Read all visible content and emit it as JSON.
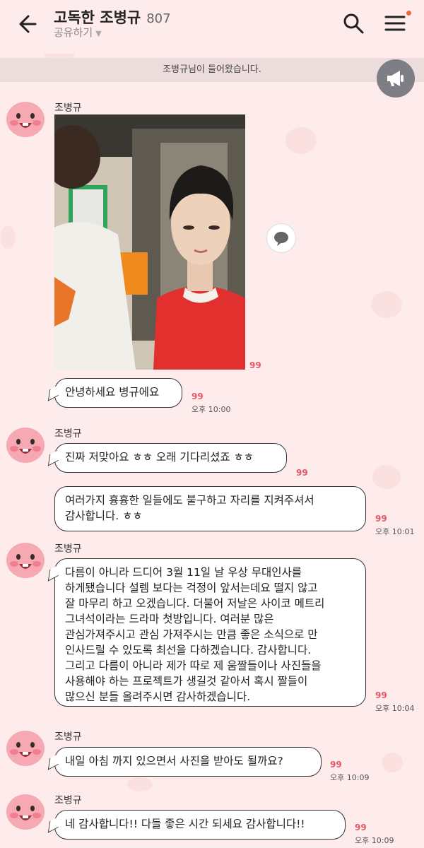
{
  "header": {
    "title": "고독한 조병규",
    "member_count": "807",
    "share_label": "공유하기"
  },
  "notice": {
    "text": "조병규님이 들어왔습니다."
  },
  "messages": {
    "m1": {
      "sender": "조병규",
      "unread_photo": "99",
      "text": "안녕하세요 병규에요",
      "unread": "99",
      "time": "오후 10:00"
    },
    "m2": {
      "sender": "조병규",
      "text1": "진짜 저맞아요 ㅎㅎ 오래 기다리셨죠 ㅎㅎ",
      "unread1": "99",
      "text2_l1": "여러가지 흉흉한 일들에도 불구하고 자리를 지켜주셔서",
      "text2_l2": "감사합니다. ㅎㅎ",
      "unread2": "99",
      "time": "오후 10:01"
    },
    "m3": {
      "sender": "조병규",
      "lines": [
        "다름이 아니라 드디어 3월 11일 날 우상 무대인사를",
        "하게됐습니다 설렘 보다는 걱정이 앞서는데요 떨지 않고",
        "잘 마무리 하고 오겠습니다. 더불어 저날은 사이코 메트리",
        "그녀석이라는 드라마 첫방입니다. 여러분 많은",
        "관심가져주시고 관심 가져주시는 만큼 좋은 소식으로 만",
        "인사드릴 수 있도록 최선을 다하겠습니다. 감사합니다.",
        "그리고 다름이 아니라 제가 따로 제 움짤들이나 사진들을",
        "사용해야 하는 프로젝트가 생길것 같아서 혹시 짤들이",
        "많으신 분들 올려주시면 감사하겠습니다."
      ],
      "unread": "99",
      "time": "오후 10:04"
    },
    "m4": {
      "sender": "조병규",
      "text": "내일 아침 까지 있으면서 사진을 받아도 될까요?",
      "unread": "99",
      "time": "오후 10:09"
    },
    "m5": {
      "sender": "조병규",
      "text": "네 감사합니다!! 다들 좋은 시간 되세요 감사합니다!!",
      "unread": "99",
      "time": "오후 10:09"
    }
  }
}
